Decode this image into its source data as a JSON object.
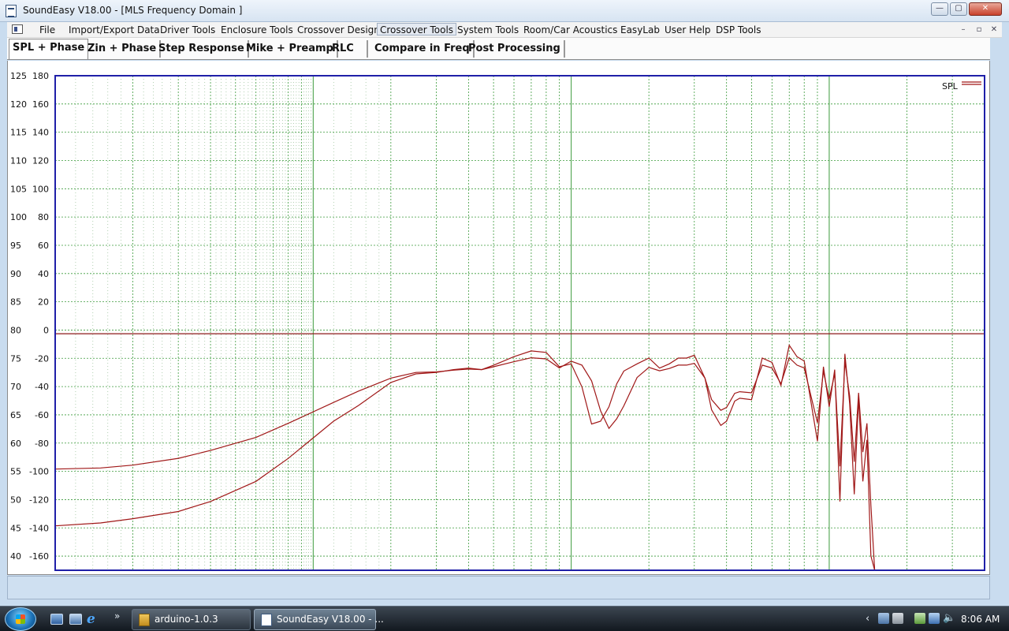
{
  "window": {
    "title": "SoundEasy V18.00 - [MLS Frequency Domain  ]",
    "min_label": "—",
    "max_label": "▢",
    "close_label": "✕"
  },
  "menu": {
    "items": [
      "File",
      "Import/Export Data",
      "Driver Tools",
      "Enclosure Tools",
      "Crossover Design",
      "Crossover Tools",
      "System Tools",
      "Room/Car Acoustics",
      "EasyLab",
      "User Help",
      "DSP Tools"
    ],
    "active_item": "Crossover Tools",
    "mdi_buttons": [
      "–",
      "▫",
      "✕"
    ]
  },
  "tabs": {
    "items": [
      "SPL + Phase",
      "Zin + Phase",
      "Step Response",
      "Mike + Preamp",
      "RLC",
      "Compare in Freq",
      "Post Processing"
    ],
    "active": "SPL + Phase"
  },
  "plot": {
    "legend_label": "SPL",
    "colors": {
      "grid": "#3b9a3b",
      "trace": "#a01818",
      "frame": "#1f1fa8",
      "zero_line": "#8b1a1a"
    }
  },
  "chart_data": {
    "type": "line",
    "x_scale": "log",
    "xlim": [
      10,
      40000
    ],
    "ylim": [
      37.5,
      125
    ],
    "secondary_ylim": [
      -165,
      180
    ],
    "left_ticks": [
      125,
      120,
      115,
      110,
      105,
      100,
      95,
      90,
      85,
      80,
      75,
      70,
      65,
      60,
      55,
      50,
      45,
      40
    ],
    "right_ticks": [
      180,
      160,
      140,
      120,
      100,
      80,
      60,
      40,
      20,
      0,
      -20,
      -40,
      -60,
      -80,
      -100,
      -120,
      -140,
      -160
    ],
    "grid": true,
    "legend": "top-right",
    "series": [
      {
        "name": "SPL",
        "x": [
          10,
          15,
          20,
          30,
          40,
          60,
          80,
          120,
          150,
          200,
          250,
          300,
          350,
          400,
          450,
          500,
          600,
          700,
          800,
          900,
          1000,
          1100,
          1200,
          1300,
          1400,
          1500,
          1600,
          1800,
          2000,
          2200,
          2400,
          2600,
          2800,
          3000,
          3300,
          3500,
          3800,
          4000,
          4300,
          4500,
          5000,
          5500,
          6000,
          6500,
          7000,
          7500,
          8000,
          9000,
          9500,
          10000,
          10500,
          11000,
          11500,
          12000,
          12500,
          13000,
          13500,
          14000,
          14500,
          15000
        ],
        "y": [
          55.4,
          55.6,
          56.1,
          57.3,
          58.7,
          61.0,
          63.5,
          67.2,
          69.2,
          71.5,
          72.5,
          72.6,
          72.9,
          73.1,
          73.0,
          73.5,
          74.4,
          75.1,
          74.9,
          73.3,
          74.5,
          73.8,
          71.0,
          65.7,
          62.6,
          64.3,
          66.6,
          71.6,
          73.4,
          72.8,
          73.2,
          73.8,
          73.8,
          74.1,
          71.5,
          67.7,
          65.8,
          66.3,
          68.8,
          69.1,
          68.9,
          73.8,
          73.3,
          70.5,
          75.1,
          73.8,
          73.3,
          63.6,
          72.7,
          67.8,
          72.3,
          55.9,
          74.4,
          68.3,
          56.7,
          68.9,
          58.4,
          63.5,
          49.0,
          37.5
        ]
      },
      {
        "name": "Phase",
        "x": [
          10,
          15,
          20,
          30,
          40,
          60,
          80,
          120,
          150,
          200,
          250,
          300,
          350,
          400,
          450,
          500,
          600,
          700,
          800,
          900,
          1000,
          1100,
          1200,
          1300,
          1400,
          1500,
          1600,
          1800,
          2000,
          2200,
          2400,
          2600,
          2800,
          3000,
          3300,
          3500,
          3800,
          4000,
          4300,
          4500,
          5000,
          5500,
          6000,
          6500,
          7000,
          7500,
          8000,
          9000,
          9500,
          10000,
          10500,
          11000,
          11500,
          12000,
          12500,
          13000,
          13500,
          14000,
          14500,
          15000
        ],
        "y": [
          -134,
          -132,
          -129,
          -124,
          -117,
          -103,
          -87,
          -61,
          -50,
          -34,
          -28,
          -27,
          -25,
          -24,
          -25,
          -22,
          -16,
          -12,
          -13,
          -23,
          -21,
          -37,
          -63,
          -61,
          -51,
          -35,
          -26,
          -21,
          -17,
          -24,
          -21,
          -17,
          -17,
          -15,
          -31,
          -53,
          -64,
          -61,
          -47,
          -45,
          -46,
          -17,
          -20,
          -36,
          -8,
          -16,
          -19,
          -75,
          -23,
          -51,
          -25,
          -117,
          -14,
          -49,
          -112,
          -45,
          -103,
          -74,
          -155,
          -167
        ]
      }
    ]
  },
  "taskbar": {
    "quicklaunch_more": "»",
    "tasks": [
      {
        "label": "arduino-1.0.3",
        "active": false
      },
      {
        "label": "SoundEasy V18.00 - ...",
        "active": true
      }
    ],
    "tray_arrow": "‹",
    "volume_icon": "🔈",
    "clock": "8:06 AM"
  }
}
